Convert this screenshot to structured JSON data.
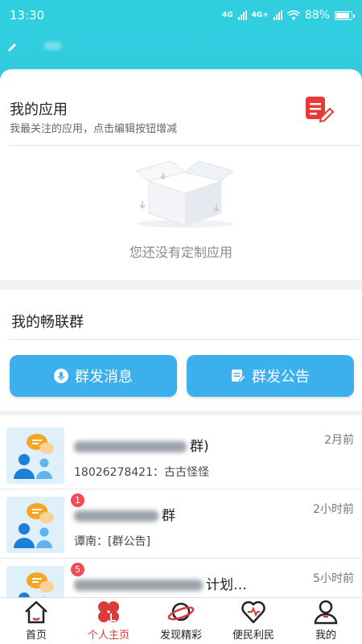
{
  "status_bar": {
    "time": "13:30",
    "network1": "4G",
    "network2": "4G+",
    "battery": "88%",
    "battery_level": 0.88
  },
  "my_apps": {
    "title": "我的应用",
    "subtitle": "我最关注的应用，点击编辑按钮增减",
    "empty_text": "您还没有定制应用"
  },
  "my_groups": {
    "title": "我的畅联群",
    "broadcast_message_label": "群发消息",
    "broadcast_notice_label": "群发公告"
  },
  "groups": [
    {
      "name": "群)",
      "time": "2月前",
      "preview": "18026278421：古古怪怪",
      "badge": ""
    },
    {
      "name": "群",
      "time": "2小时前",
      "preview": "谭南：[群公告]",
      "badge": "1"
    },
    {
      "name": "计划…",
      "time": "5小时前",
      "preview": "",
      "badge": "5"
    }
  ],
  "tabs": [
    {
      "label": "首页"
    },
    {
      "label": "个人主页"
    },
    {
      "label": "发现精彩"
    },
    {
      "label": "便民利民"
    },
    {
      "label": "我的"
    }
  ],
  "colors": {
    "header": "#2fcfe0",
    "button": "#3bb0ec",
    "active_tab": "#d93a3a",
    "badge": "#f24b55"
  }
}
